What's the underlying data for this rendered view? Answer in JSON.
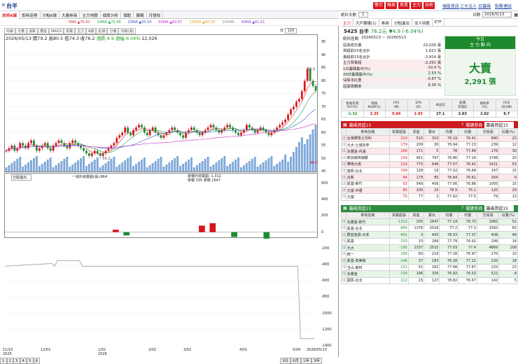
{
  "window": {
    "stock_label": "台半"
  },
  "top_buttons": [
    "警示",
    "報表",
    "買賣",
    "主力",
    "技術"
  ],
  "top_links": [
    "個股資訊",
    "三大法人",
    "日籌碼",
    "點擊連結"
  ],
  "main_tabs": [
    "技術K線",
    "即時走勢",
    "分點K線",
    "大量券商",
    "主力地圖",
    "個股分析",
    "個股",
    "籌碼",
    "月營收"
  ],
  "ma_row": [
    {
      "label": "5MA",
      "value": "▲76.42",
      "color": "#c8323c"
    },
    {
      "label": "10MA",
      "value": "▲70.49",
      "color": "#1aa33a"
    },
    {
      "label": "20MA",
      "value": "▲65.54",
      "color": "#3a58c8"
    },
    {
      "label": "60MA",
      "value": "▲60.87",
      "color": "#cc2ccc"
    },
    {
      "label": "120MA",
      "value": "▲60.00",
      "color": "#e4a21c"
    },
    {
      "label": "240MA",
      "value": "",
      "color": "#8a8a8a"
    },
    {
      "label": "40MA",
      "value": "▲61.61",
      "color": "#8a3cc8"
    }
  ],
  "chart_toolbar": [
    "均線",
    "分量",
    "漲跌",
    "量能",
    "MACD",
    "買賣",
    "主力",
    "K線",
    "紅綠",
    "分價",
    "日線(週)"
  ],
  "chart_info": {
    "date": "2026/05/13",
    "open_label": "開",
    "open": "79.2",
    "high_label": "高",
    "high": "80.5",
    "low_label": "低",
    "low": "74.3",
    "close_label": "收",
    "close": "76.2",
    "change_label": "漲跌",
    "change": "-4.9",
    "pct_label": "漲幅",
    "pct": "-6.04%",
    "volume": "22,026",
    "period": "日",
    "count": "120"
  },
  "chart_data": [
    {
      "type": "candlestick",
      "ylim": [
        45,
        95
      ],
      "yticks": [
        95,
        90,
        85,
        80,
        75,
        70,
        65,
        60,
        55,
        50,
        45
      ],
      "xticks": [
        "11/10",
        "12/01",
        "1/02",
        "2/02",
        "3/02",
        "4/01",
        "5/04",
        "2026/05/13"
      ],
      "x_year_labels": [
        "2025",
        "2026"
      ],
      "annotations": [
        {
          "label": "84.6",
          "value": 84.6
        },
        {
          "label": "50.2",
          "value": 50.2
        },
        {
          "label": "48.5",
          "value": 48.5
        }
      ],
      "close_series": [
        53,
        54,
        55,
        53,
        54,
        56,
        55,
        54,
        56,
        57,
        55,
        53,
        54,
        55,
        56,
        54,
        53,
        55,
        56,
        57,
        56,
        55,
        54,
        56,
        57,
        56,
        55,
        54,
        53,
        52,
        51,
        52,
        53,
        52,
        51,
        52,
        53,
        54,
        55,
        56,
        58,
        59,
        60,
        62,
        60,
        59,
        61,
        62,
        63,
        62,
        60,
        59,
        61,
        62,
        60,
        59,
        58,
        59,
        60,
        61,
        62,
        61,
        60,
        59,
        58,
        60,
        61,
        62,
        61,
        60,
        59,
        60,
        61,
        62,
        63,
        62,
        61,
        60,
        61,
        62,
        63,
        62,
        61,
        60,
        59,
        60,
        61,
        63,
        62,
        61,
        60,
        61,
        62,
        61,
        60,
        59,
        60,
        61,
        62,
        63,
        64,
        65,
        67,
        69,
        70,
        72,
        73,
        76,
        80,
        84.6,
        80,
        78,
        76.2
      ]
    },
    {
      "type": "bar",
      "title": "分點進出",
      "labels": [
        "一週外資賣超(張):864",
        "累積外資賣超:-1,312"
      ],
      "ylim": [
        -1400,
        600
      ],
      "yticks": [
        600,
        400,
        200,
        0,
        -200,
        -400,
        -600,
        -800,
        -1000,
        -1200,
        -1400
      ],
      "values_note": "day-by-day net buy/sell from foreign branch",
      "values": [
        0,
        0,
        0,
        0,
        0,
        0,
        0,
        0,
        0,
        0,
        0,
        0,
        0,
        0,
        0,
        0,
        0,
        0,
        0,
        0,
        0,
        0,
        0,
        0,
        0,
        0,
        0,
        0,
        0,
        0,
        0,
        0,
        0,
        0,
        0,
        0,
        0,
        0,
        0,
        0,
        0,
        0,
        0,
        0,
        0,
        0,
        0,
        0,
        0,
        0,
        0,
        0,
        0,
        0,
        0,
        0,
        0,
        0,
        0,
        0,
        0,
        0,
        0,
        0,
        0,
        0,
        0,
        0,
        0,
        0,
        0,
        0,
        0,
        0,
        0,
        0,
        0,
        0,
        0,
        0,
        0,
        0,
        0,
        0,
        0,
        0,
        0,
        0,
        0,
        0,
        0,
        0,
        0,
        0,
        0,
        0,
        0,
        0,
        0,
        0,
        0,
        0,
        0,
        0,
        0,
        0,
        0,
        0,
        0,
        0,
        0,
        0,
        0
      ]
    }
  ],
  "sub_labels": {
    "sub1_left": "分點進出",
    "sub1_mid": "一週外資賣超(張):864",
    "sub1_right": "累積外資賣超:-1,312",
    "sub1_right2": "累積 335 累積 1647"
  },
  "page_tabs": [
    "1",
    "2",
    "3",
    "4",
    "5",
    "6"
  ],
  "period_tabs": [
    "3日",
    "6月",
    "1年",
    "3年"
  ],
  "right": {
    "label_days": "統計天數",
    "days_value": "1",
    "tabs": [
      "主力",
      "大戶籌碼(1)",
      "券商",
      "分點進出",
      "法人持股",
      "ETF"
    ],
    "date_label": "日期",
    "date_value": "2026/5/13",
    "stock_title": "5425 台半",
    "price": "76.2元",
    "change": "▼4.9 (-6.04%)",
    "stats_title": "統計區間",
    "stats_range": "20260513 ~ 20260513",
    "stats": [
      {
        "label": "區間成交量",
        "value": "22,026 張"
      },
      {
        "label": "買超前15名合計",
        "value": "1,623 張"
      },
      {
        "label": "賣超前15名合計",
        "value": "-3,914 張"
      },
      {
        "label": "主力買賣超",
        "value": "-2,291 張"
      },
      {
        "label": "1日籌碼集中(%)",
        "value": "-10.4 %"
      },
      {
        "label": "20日籌碼集中(%)",
        "value": "2.53 %"
      },
      {
        "label": "佔股本比重",
        "value": "-0.87 %"
      },
      {
        "label": "區間周轉率",
        "value": "8.36 %"
      }
    ],
    "today_label": "今日",
    "today_sub": "主 力 動 向",
    "big_label": "大賣",
    "big_value": "2,291 張",
    "fin_headers": [
      "營收年增\nYoY(%)",
      "營收\nMoM(%)",
      "EPS\n(季)",
      "EPS\n(年)",
      "本益比",
      "股價\n淨值比",
      "殖利率\n(%)",
      "ROE\n(近4季)"
    ],
    "fin_values": [
      "-1.32",
      "2.35",
      "0.84",
      "1.93",
      "27.1",
      "2.63",
      "2.62",
      "6.7"
    ],
    "buy_title": "籌碼買超15",
    "sell_title": "籌碼賣超15",
    "filter_label": "關鍵券商",
    "filter_value": "籌碼買超15",
    "sell_filter_value": "籌碼賣超15",
    "table_headers": [
      "",
      "券商名稱",
      "買賣超張",
      "買進",
      "賣出",
      "均價",
      "均價",
      "交易張",
      "佔量(%)"
    ],
    "buy_rows": [
      [
        "台灣摩根士丹利",
        "220",
        "510",
        "310",
        "76.19",
        "76.41",
        "840",
        "23"
      ],
      [
        "元大-土城永寧",
        "179",
        "209",
        "30",
        "76.94",
        "77.23",
        "239",
        "12"
      ],
      [
        "永豐金-內湖",
        "166",
        "171",
        "5",
        "78",
        "77.48",
        "176",
        "30"
      ],
      [
        "新加坡商瑞銀",
        "154",
        "951",
        "797",
        "76.86",
        "77.14",
        "1748",
        "20"
      ],
      [
        "華南大通",
        "129",
        "775",
        "646",
        "77.07",
        "76.42",
        "1421",
        "53"
      ],
      [
        "富邦-台北",
        "109",
        "128",
        "19",
        "77.02",
        "76.64",
        "147",
        "15"
      ],
      [
        "台新",
        "94",
        "179",
        "85",
        "76.84",
        "76.61",
        "264",
        "6"
      ],
      [
        "凱基-新竹",
        "93",
        "549",
        "456",
        "77.06",
        "76.86",
        "1005",
        "15"
      ],
      [
        "元富-中壢",
        "80",
        "100",
        "20",
        "78.9",
        "75.1",
        "120",
        "29"
      ],
      [
        "元富-",
        "75",
        "77",
        "2",
        "77.92",
        "77.5",
        "79",
        "13"
      ]
    ],
    "sell_rows": [
      [
        "永豐金-新竹",
        "-1312",
        "335",
        "1647",
        "77.14",
        "76.73",
        "1982",
        "52"
      ],
      [
        "凱基-台北",
        "-640",
        "1376",
        "2016",
        "77.2",
        "77.3",
        "3392",
        "83"
      ],
      [
        "群益金鼎-大安",
        "-402",
        "3",
        "405",
        "78.03",
        "77.37",
        "408",
        "48"
      ],
      [
        "凱基",
        "-233",
        "33",
        "266",
        "77.79",
        "76.91",
        "299",
        "14"
      ],
      [
        "元大",
        "-195",
        "2337",
        "2532",
        "77.03",
        "77.4",
        "4869",
        "108"
      ],
      [
        "統一",
        "-156",
        "60",
        "216",
        "77.28",
        "76.97",
        "276",
        "10"
      ],
      [
        "凱基-高美館",
        "-146",
        "37",
        "183",
        "76.28",
        "77.22",
        "220",
        "18"
      ],
      [
        "玉山-東林",
        "-131",
        "51",
        "182",
        "77.48",
        "77.87",
        "233",
        "23"
      ],
      [
        "永豐金",
        "-130",
        "196",
        "326",
        "76.92",
        "76.53",
        "522",
        "-9"
      ],
      [
        "國票-台北",
        "-112",
        "15",
        "127",
        "78.82",
        "76.67",
        "142",
        "5"
      ]
    ]
  }
}
